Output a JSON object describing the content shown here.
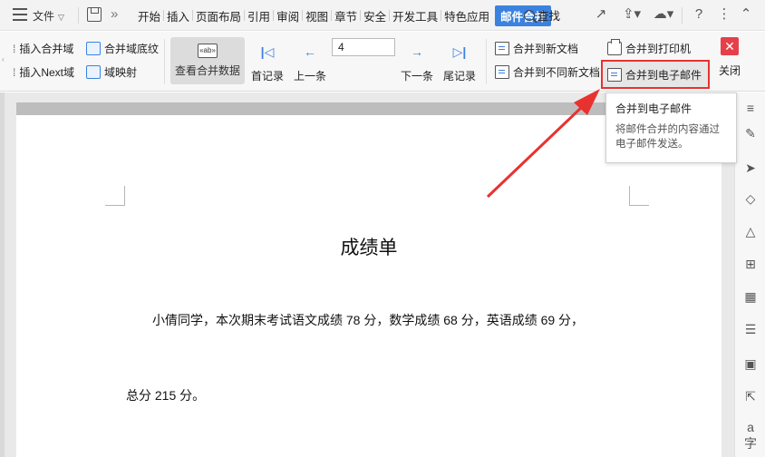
{
  "menubar": {
    "file_label": "文件",
    "tabs": [
      "开始",
      "插入",
      "页面布局",
      "引用",
      "审阅",
      "视图",
      "章节",
      "安全",
      "开发工具",
      "特色应用"
    ],
    "active_tab": "邮件合并",
    "search_label": "查找",
    "icons": [
      "hamburger-icon",
      "save-icon",
      "more-icon",
      "share-icon",
      "upload-icon",
      "cloud-icon",
      "help-icon",
      "collapse-icon"
    ]
  },
  "ribbon": {
    "insert_merge_field": "插入合并域",
    "insert_next_field": "插入Next域",
    "merge_field_shading": "合并域底纹",
    "field_mapping": "域映射",
    "view_merged_data": "查看合并数据",
    "first_record": "首记录",
    "prev_record": "上一条",
    "record_number": "4",
    "next_record": "下一条",
    "last_record": "尾记录",
    "merge_new_doc": "合并到新文档",
    "merge_diff_docs": "合并到不同新文档",
    "merge_printer": "合并到打印机",
    "merge_email": "合并到电子邮件",
    "close": "关闭"
  },
  "tooltip": {
    "title": "合并到电子邮件",
    "description": "将邮件合并的内容通过电子邮件发送。"
  },
  "document": {
    "title": "成绩单",
    "line1": "小倩同学，本次期末考试语文成绩  78 分，数学成绩  68 分，英语成绩    69 分，",
    "line2": "总分  215  分。"
  },
  "colors": {
    "accent": "#3b82e0",
    "highlight_border": "#e8322f",
    "arrow": "#e8322f",
    "close_button": "#e5404a"
  }
}
